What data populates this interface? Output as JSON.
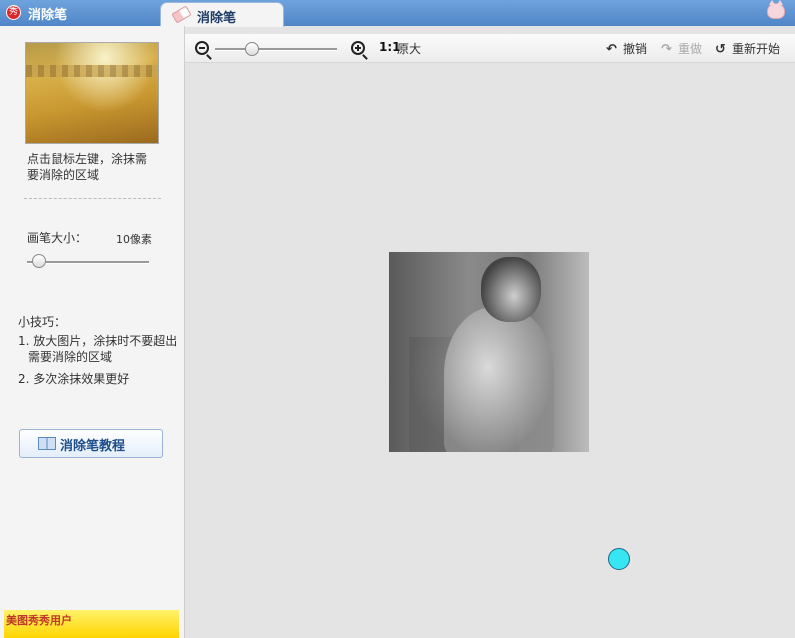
{
  "titlebar": {
    "app_logo_text": "秀",
    "app_title": "消除笔",
    "tab_label": "消除笔"
  },
  "left_panel": {
    "instruction": "点击鼠标左键，涂抹需要消除的区域",
    "brush_size_label": "画笔大小：",
    "brush_size_value": "10像素",
    "tips_title": "小技巧：",
    "tips": [
      "1. 放大图片，涂抹时不要超出需要消除的区域",
      "2. 多次涂抹效果更好"
    ],
    "tutorial_button": "消除笔教程",
    "ad_text": "美图秀秀用户"
  },
  "toolbar": {
    "actual_size_icon": "1:1",
    "actual_size_label": "原大",
    "undo_label": "撤销",
    "redo_label": "重做",
    "restart_label": "重新开始"
  },
  "colors": {
    "titlebar": "#4f86c8",
    "brush_cursor": "#36e6f3",
    "tab_text": "#1f3e67"
  }
}
